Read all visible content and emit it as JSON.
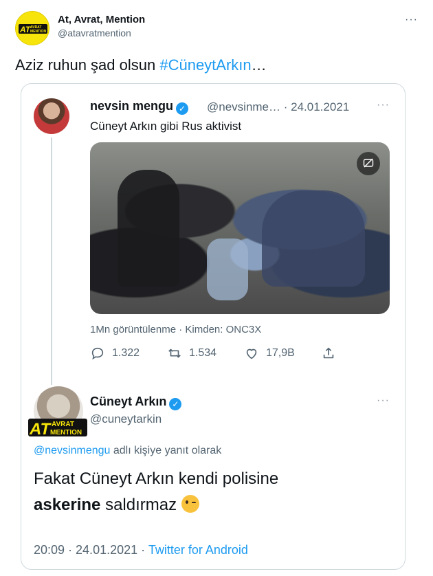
{
  "tweet": {
    "author_name": "At, Avrat, Mention",
    "author_handle": "@atavratmention",
    "more_glyph": "···",
    "text_plain": "Aziz ruhun şad olsun ",
    "hashtag": "#CüneytArkın",
    "text_tail": "…",
    "logo_line1": "AVRAT",
    "logo_line2": "MENTION",
    "logo_big": "AT"
  },
  "quoted": {
    "author_name": "nevsin mengu",
    "author_handle": "@nevsinme…",
    "date": "· 24.01.2021",
    "more_glyph": "···",
    "text": "Cüneyt Arkın gibi Rus aktivist",
    "views_line": "1Mn görüntülenme · Kimden: ONC3X",
    "actions": {
      "reply_count": "1.322",
      "retweet_count": "1.534",
      "like_count": "17,9B"
    },
    "icons": [
      "reply-icon",
      "retweet-icon",
      "like-icon",
      "share-icon",
      "captions-icon"
    ]
  },
  "reply": {
    "author_name": "Cüneyt Arkın",
    "author_handle": "@cuneytarkin",
    "more_glyph": "···",
    "reply_mention": "@nevsinmengu",
    "reply_suffix": " adlı kişiye yanıt olarak",
    "text_line1": "Fakat Cüneyt Arkın kendi polisine",
    "text_bold": "askerine",
    "text_line2_rest": " saldırmaz ",
    "time": "20:09 · 24.01.2021 · ",
    "source": "Twitter for Android",
    "watermark_line1": "AVRAT",
    "watermark_line2": "MENTION",
    "watermark_big": "AT"
  },
  "colors": {
    "accent": "#1d9bf0",
    "secondary_text": "#536471",
    "border": "#cfd9de",
    "logo_yellow": "#f7e40a"
  }
}
